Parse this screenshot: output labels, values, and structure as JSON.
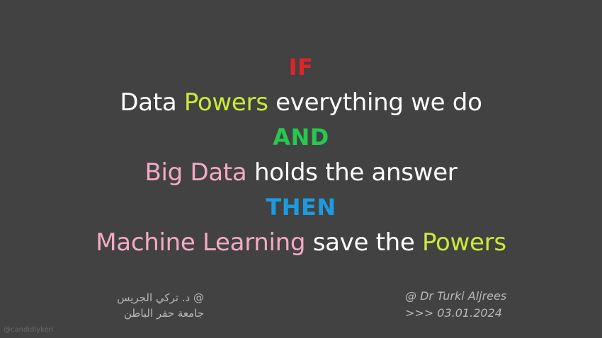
{
  "colors": {
    "background": "#424242",
    "white": "#ffffff",
    "red": "#e0232a",
    "lime": "#c9ea3b",
    "green": "#27c84e",
    "pink": "#f3aac6",
    "blue": "#1c9be1",
    "gray": "#b8b8b8"
  },
  "slide": {
    "if_keyword": "IF",
    "line2": {
      "w1": "Data ",
      "accent": "Powers",
      "rest": " everything we do"
    },
    "and_keyword": "AND",
    "line4": {
      "accent": "Big Data",
      "rest": " holds the answer"
    },
    "then_keyword": "THEN",
    "line6": {
      "accent1": "Machine Learning",
      "mid": " save the ",
      "accent2": "Powers"
    }
  },
  "signature_arabic": {
    "line1": "@ د. تركي الجريس",
    "line2": "جامعة حفر الباطن"
  },
  "signature_english": {
    "line1": "@ Dr Turki Aljrees",
    "line2": ">>> 03.01.2024"
  },
  "watermark": "@candidlykeri"
}
